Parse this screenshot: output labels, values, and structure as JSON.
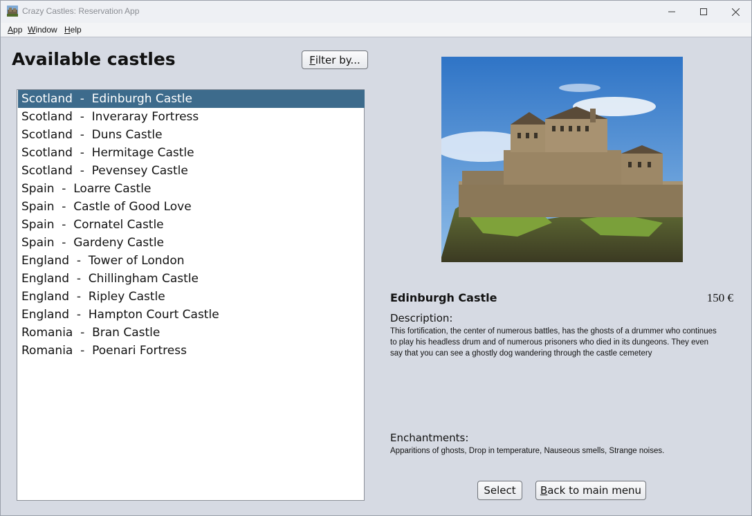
{
  "window": {
    "title": "Crazy Castles: Reservation App",
    "minimize_icon": "minimize-icon",
    "maximize_icon": "maximize-icon",
    "close_icon": "close-icon"
  },
  "menubar": {
    "items": [
      {
        "underline": "A",
        "rest": "pp"
      },
      {
        "underline": "W",
        "rest": "indow"
      },
      {
        "underline": "H",
        "rest": "elp"
      }
    ]
  },
  "castles_panel": {
    "heading": "Available castles",
    "filter_button": {
      "underline": "F",
      "rest": "ilter by..."
    },
    "items": [
      "Scotland  -  Edinburgh Castle",
      "Scotland  -  Inveraray Fortress",
      "Scotland  -  Duns Castle",
      "Scotland  -  Hermitage Castle",
      "Scotland  -  Pevensey Castle",
      "Spain  -  Loarre Castle",
      "Spain  -  Castle of Good Love",
      "Spain  -  Cornatel Castle",
      "Spain  -  Gardeny Castle",
      "England  -  Tower of London",
      "England  -  Chillingham Castle",
      "England  -  Ripley Castle",
      "England  -  Hampton Court Castle",
      "Romania  -  Bran Castle",
      "Romania  -  Poenari Fortress"
    ],
    "selected_index": 0
  },
  "details": {
    "name": "Edinburgh Castle",
    "price": "150 €",
    "description_label": "Description:",
    "description": "This fortification, the center of numerous battles, has the ghosts of a drummer who continues to play his headless drum and of numerous prisoners who died in its dungeons. They even say that you can see a ghostly dog wandering through the castle cemetery",
    "enchantments_label": "Enchantments:",
    "enchantments": "Apparitions of ghosts, Drop in temperature, Nauseous smells, Strange noises."
  },
  "actions": {
    "select_label": "Select",
    "back_button": {
      "underline": "B",
      "rest": "ack to main menu"
    }
  },
  "colors": {
    "selection": "#3d6b8c",
    "background": "#d6dae3"
  }
}
